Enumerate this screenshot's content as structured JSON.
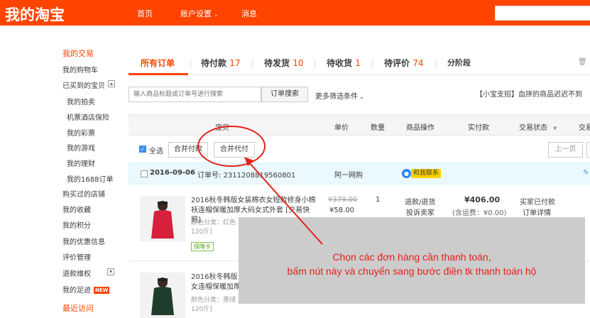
{
  "header": {
    "logo": "我的淘宝",
    "nav": [
      {
        "label": "首页"
      },
      {
        "label": "账户设置"
      },
      {
        "label": "消息"
      }
    ]
  },
  "sidebar": {
    "section_title": "我的交易",
    "items": [
      "我的购物车",
      "已买到的宝贝",
      "我的拍卖",
      "机票酒店保险",
      "我的彩票",
      "我的游戏",
      "我的理财",
      "我的1688订单",
      "购买过的店铺",
      "我的收藏",
      "我的积分",
      "我的优惠信息",
      "评价管理",
      "退款维权",
      "我的足迹"
    ],
    "new_badge": "NEW",
    "recent_title": "最近访问"
  },
  "tabs": [
    {
      "label": "所有订单",
      "count": ""
    },
    {
      "label": "待付款",
      "count": "17"
    },
    {
      "label": "待发货",
      "count": "10"
    },
    {
      "label": "待收货",
      "count": "1"
    },
    {
      "label": "待评价",
      "count": "74"
    },
    {
      "label": "分阶段",
      "count": ""
    }
  ],
  "trash_label": "回",
  "search": {
    "placeholder": "输入商品标题或订单号进行搜索",
    "button": "订单搜索",
    "more_filters": "更多筛选条件"
  },
  "notice": "【小宝支招】血拼的商品迟迟不到",
  "table_header": [
    "宝贝",
    "单价",
    "数量",
    "商品操作",
    "实付款",
    "交易状态",
    "交易"
  ],
  "actions": {
    "select_all": "全选",
    "merge_pay": "合并付款",
    "merge_proxy_pay": "合并代付",
    "prev_page": "上一页"
  },
  "order": {
    "date": "2016-09-06",
    "order_no_label": "订单号:",
    "order_no": "2311208819560801",
    "shop": "阿一网购",
    "contact": "和我联系"
  },
  "products": [
    {
      "title": "2016秋冬韩版女装棉衣女短款修身小棉袄连帽保暖加厚大码女式外套 [交易快照]",
      "attr1": "颜色分类：红色",
      "attr2": "120斤]",
      "guarantee": "保障卡",
      "original_price": "¥379.00",
      "price": "¥58.00",
      "qty": "1",
      "ops": [
        "退款/退货",
        "投诉卖家"
      ],
      "total": "¥406.00",
      "shipping": "(含运费：¥0.00)",
      "status": [
        "买家已付款",
        "订单详情"
      ]
    },
    {
      "title": "2016秋冬韩版女连帽保暖加厚",
      "attr1": "颜色分类：墨绿",
      "attr2": "120斤]"
    }
  ],
  "annotation": {
    "line1": "Chọn các đơn hàng cần thanh toán,",
    "line2": "bấm nút này và chuyển sang bước điền tk thanh toán hộ",
    "color": "#e62117"
  },
  "colors": {
    "brand": "#ff4400",
    "order_header_bg": "#eaf8ff"
  }
}
